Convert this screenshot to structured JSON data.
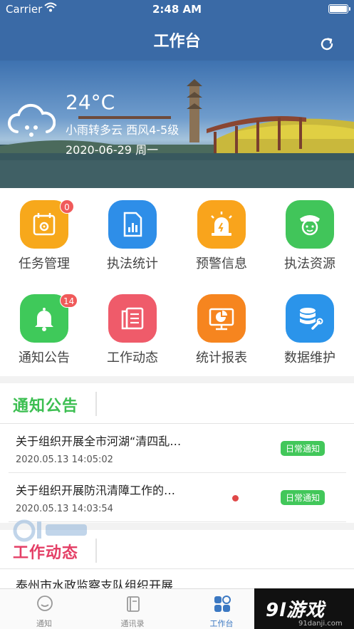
{
  "status_bar": {
    "carrier": "Carrier",
    "time": "2:48 AM"
  },
  "nav": {
    "title": "工作台",
    "refresh_icon": "refresh-icon"
  },
  "weather": {
    "temperature": "24°C",
    "description": "小雨转多云  西风4-5级",
    "date": "2020-06-29  周一",
    "icon": "cloud-rain-icon"
  },
  "grid": [
    {
      "label": "任务管理",
      "icon": "calendar-gear-icon",
      "color": "#f7a81b",
      "badge": "0"
    },
    {
      "label": "执法统计",
      "icon": "document-chart-icon",
      "color": "#2e8ee8",
      "badge": ""
    },
    {
      "label": "预警信息",
      "icon": "alarm-light-icon",
      "color": "#f9a41c",
      "badge": ""
    },
    {
      "label": "执法资源",
      "icon": "officer-icon",
      "color": "#41c55a",
      "badge": ""
    },
    {
      "label": "通知公告",
      "icon": "bell-icon",
      "color": "#3fc95a",
      "badge": "14"
    },
    {
      "label": "工作动态",
      "icon": "document-stack-icon",
      "color": "#ef5b6a",
      "badge": ""
    },
    {
      "label": "统计报表",
      "icon": "monitor-chart-icon",
      "color": "#f6851f",
      "badge": ""
    },
    {
      "label": "数据维护",
      "icon": "database-wrench-icon",
      "color": "#2b94ea",
      "badge": ""
    }
  ],
  "notice": {
    "title": "通知公告",
    "items": [
      {
        "title": "关于组织开展全市河湖“清四乱…",
        "time": "2020.05.13 14:05:02",
        "tag": "日常通知",
        "unread": false
      },
      {
        "title": "关于组织开展防汛清障工作的…",
        "time": "2020.05.13 14:03:54",
        "tag": "日常通知",
        "unread": true
      }
    ]
  },
  "dynamic": {
    "title": "工作动态",
    "preview": "泰州市水政监察支队组织开展"
  },
  "tabs": [
    {
      "label": "通知",
      "icon": "chat-bubble-icon",
      "active": false
    },
    {
      "label": "通讯录",
      "icon": "contacts-book-icon",
      "active": false
    },
    {
      "label": "工作台",
      "icon": "workbench-grid-icon",
      "active": true
    }
  ],
  "watermark": {
    "brand": "9l游戏",
    "site": "91danji.com"
  },
  "colors": {
    "primary": "#3a6aa6",
    "notice_green": "#3dbf52",
    "dynamic_red": "#e43f66",
    "tag_green": "#42c75a",
    "tab_active": "#3b78c2"
  }
}
